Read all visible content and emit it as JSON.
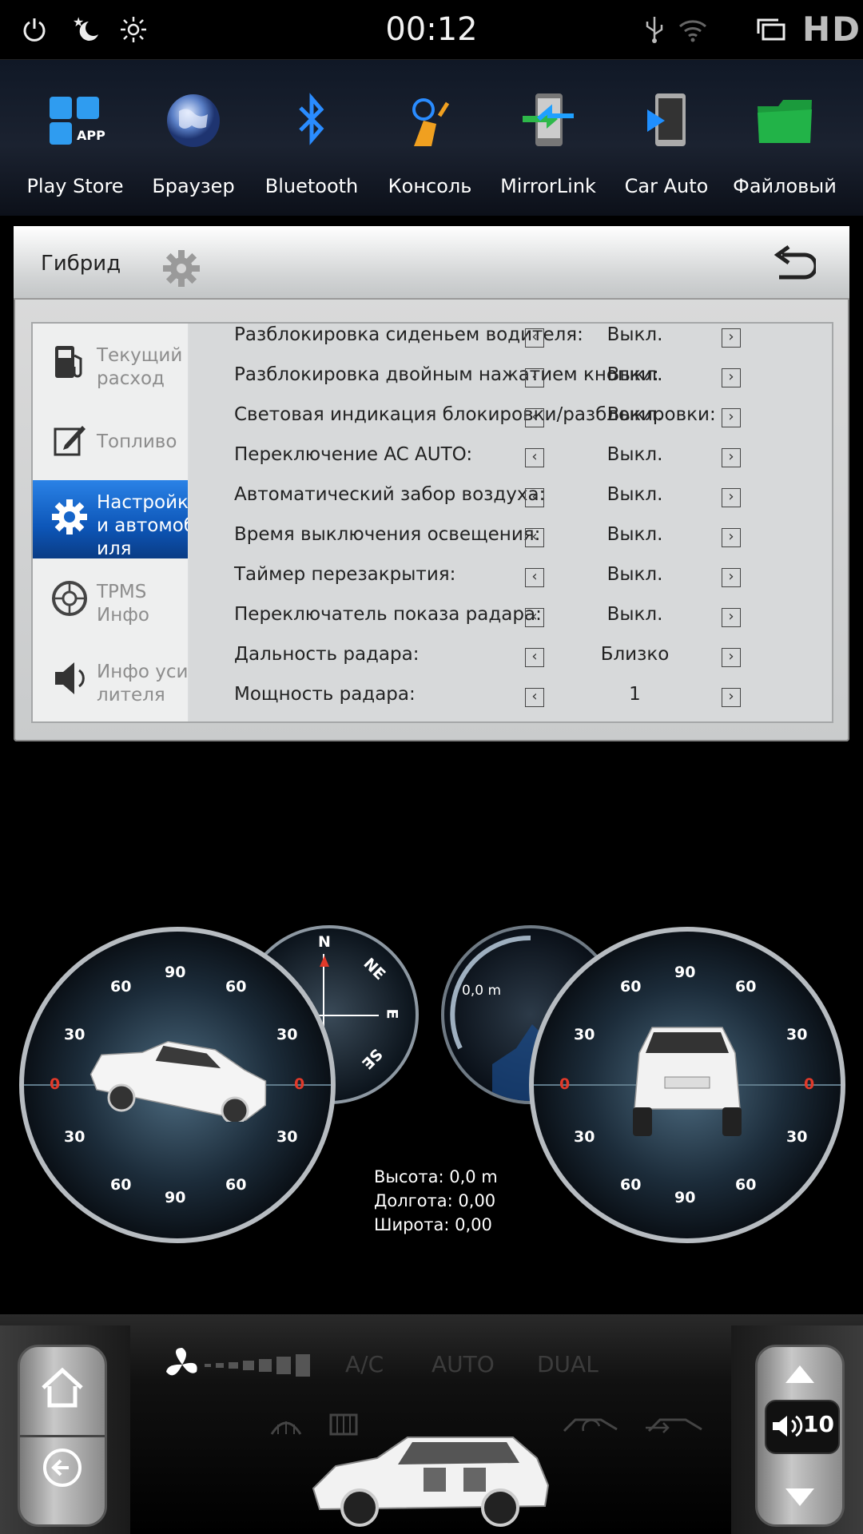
{
  "status_bar": {
    "time": "00:12",
    "hd_label": "HD",
    "icons": [
      "power-icon",
      "night-mode-icon",
      "brightness-icon",
      "usb-icon",
      "wifi-icon",
      "windows-icon"
    ]
  },
  "dock": {
    "apps": [
      {
        "label": "Play Store",
        "icon": "app-store-icon"
      },
      {
        "label": "Браузер",
        "icon": "globe-icon"
      },
      {
        "label": "Bluetooth",
        "icon": "bluetooth-icon"
      },
      {
        "label": "Консоль",
        "icon": "steering-console-icon"
      },
      {
        "label": "MirrorLink",
        "icon": "mirrorlink-icon"
      },
      {
        "label": "Car Auto",
        "icon": "car-auto-icon"
      },
      {
        "label": "Файловый",
        "icon": "folder-icon"
      }
    ]
  },
  "panel": {
    "title": "Гибрид",
    "sidebar": [
      {
        "label": "Текущий\nрасход",
        "icon": "fuel-pump-icon",
        "active": false
      },
      {
        "label": "Топливо",
        "icon": "edit-note-icon",
        "active": false
      },
      {
        "label": "Настройк\nи автомоб\nиля",
        "icon": "settings-gear-icon",
        "active": true
      },
      {
        "label": "TPMS\nИнфо",
        "icon": "tire-icon",
        "active": false
      },
      {
        "label": "Инфо уси\nлителя",
        "icon": "speaker-icon",
        "active": false
      }
    ],
    "rows": [
      {
        "label": "Разблокировка сиденьем водителя:",
        "value": "Выкл."
      },
      {
        "label": "Разблокировка двойным нажатием кнопки:",
        "value": "Выкл."
      },
      {
        "label": "Световая индикация блокировки/разблокировки:",
        "value": "Выкл."
      },
      {
        "label": "Переключение AC AUTO:",
        "value": "Выкл."
      },
      {
        "label": "Автоматический забор воздуха:",
        "value": "Выкл."
      },
      {
        "label": "Время выключения освещения:",
        "value": "Выкл."
      },
      {
        "label": "Таймер перезакрытия:",
        "value": "Выкл."
      },
      {
        "label": "Переключатель показа радара:",
        "value": "Выкл."
      },
      {
        "label": "Дальность радара:",
        "value": "Близко"
      },
      {
        "label": "Мощность радара:",
        "value": "1"
      }
    ]
  },
  "gauges": {
    "left_ticks": {
      "top": "90",
      "upper": "60",
      "mid": "30",
      "zero": "0"
    },
    "right_ticks": {
      "top": "90",
      "upper": "60",
      "mid": "30",
      "zero": "0"
    },
    "compass": {
      "n": "N",
      "ne": "NE",
      "e": "E",
      "se": "SE",
      "nw": "N"
    },
    "altimeter": "0,0 m",
    "gps": {
      "altitude": "Высота: 0,0 m",
      "longitude": "Долгота: 0,00",
      "latitude": "Широта: 0,00"
    }
  },
  "climate": {
    "ac": "A/C",
    "auto": "AUTO",
    "dual": "DUAL"
  },
  "volume": {
    "level": "10"
  }
}
